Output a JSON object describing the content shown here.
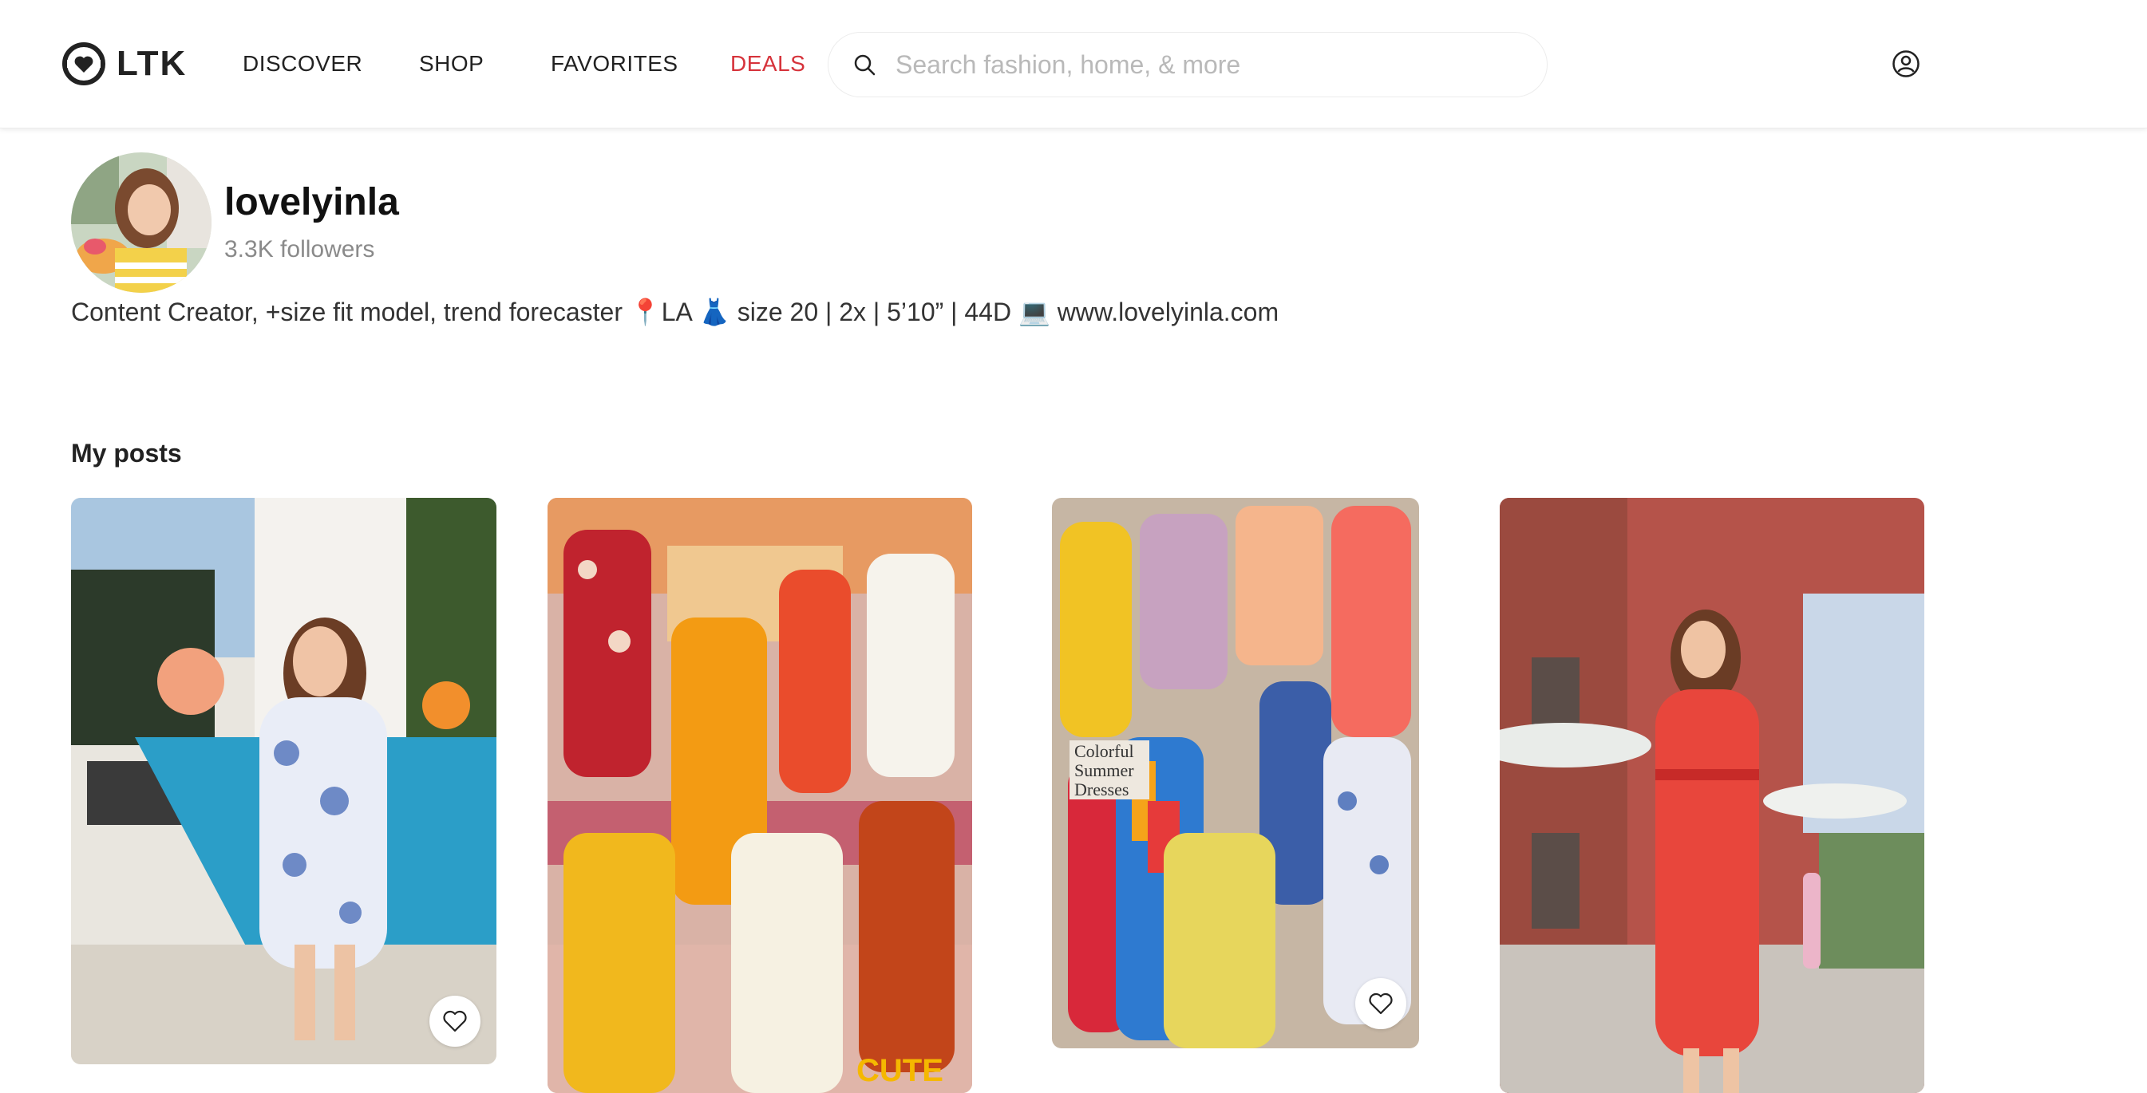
{
  "header": {
    "logo_text": "LTK",
    "nav": [
      "DISCOVER",
      "SHOP",
      "FAVORITES",
      "DEALS"
    ],
    "search_placeholder": "Search fashion, home, & more",
    "accent_color": "#d6333b"
  },
  "profile": {
    "username": "lovelyinla",
    "followers": "3.3K followers",
    "bio": "Content Creator, +size fit model, trend forecaster 📍LA 👗 size 20 | 2x | 5’10” | 44D 💻 www.lovelyinla.com"
  },
  "posts_section": {
    "title": "My posts",
    "posts": [
      {
        "description": "Poolside floral off-shoulder dress"
      },
      {
        "description": "Collage of colorful plus-size outfits",
        "overlay": "CUTE"
      },
      {
        "description": "Colorful summer dresses collage",
        "overlay": "Colorful Summer Dresses"
      },
      {
        "description": "Red gingham midi dress in courtyard"
      }
    ]
  },
  "icons": {
    "logo": "ltk-heart-logo-icon",
    "search": "search-icon",
    "account": "account-icon",
    "favorite": "heart-icon"
  }
}
